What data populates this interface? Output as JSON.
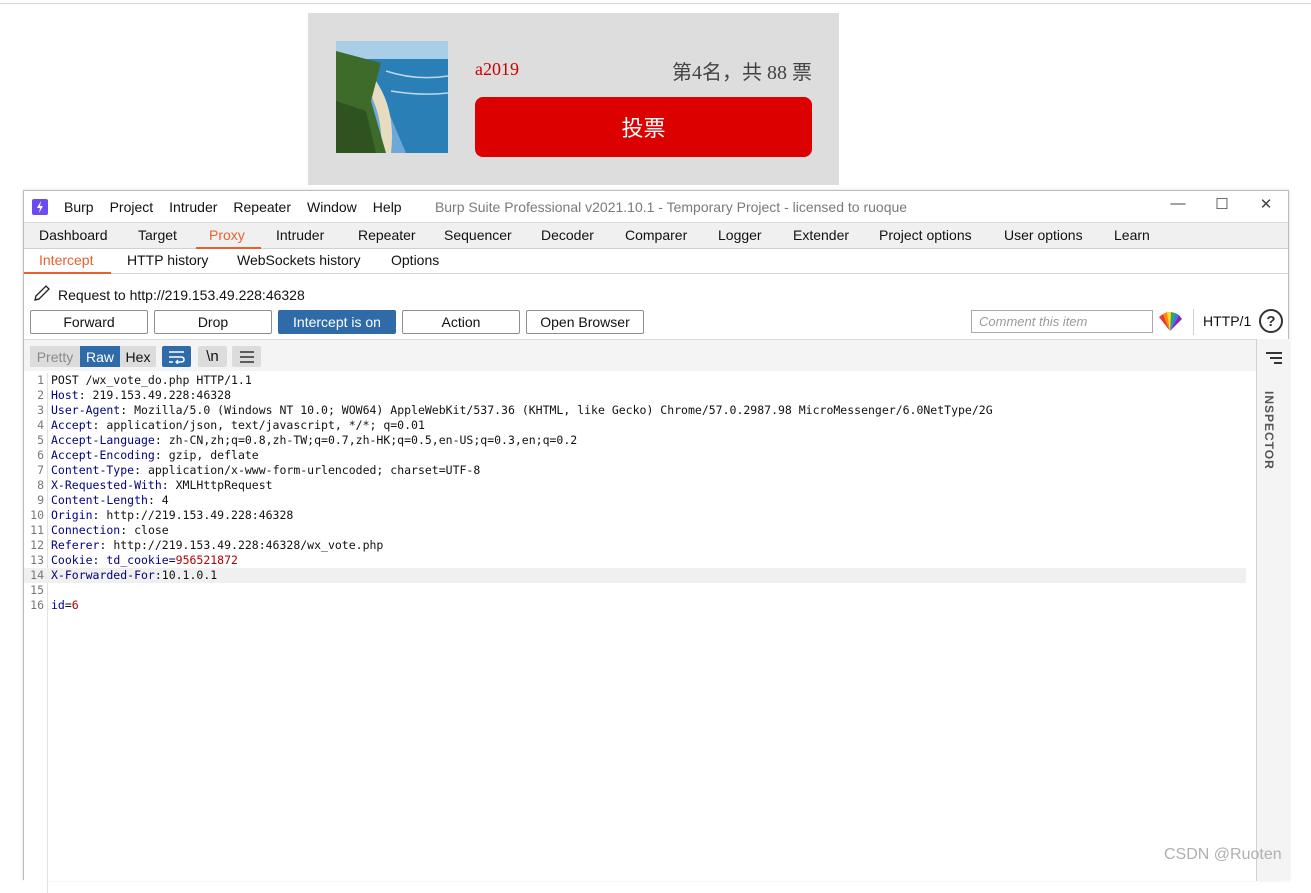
{
  "vote_card": {
    "name": "a2019",
    "rank_text": "第4名，共 88 票",
    "vote_button": "投票",
    "image_desc_icon": "beach-photo"
  },
  "burp": {
    "menu": [
      "Burp",
      "Project",
      "Intruder",
      "Repeater",
      "Window",
      "Help"
    ],
    "title": "Burp Suite Professional v2021.10.1 - Temporary Project - licensed to ruoque",
    "window_controls": [
      "—",
      "☐",
      "✕"
    ],
    "main_tabs": [
      "Dashboard",
      "Target",
      "Proxy",
      "Intruder",
      "Repeater",
      "Sequencer",
      "Decoder",
      "Comparer",
      "Logger",
      "Extender",
      "Project options",
      "User options",
      "Learn"
    ],
    "active_main_tab": "Proxy",
    "sub_tabs": [
      "Intercept",
      "HTTP history",
      "WebSockets history",
      "Options"
    ],
    "active_sub_tab": "Intercept",
    "request_to": "Request to http://219.153.49.228:46328",
    "buttons": {
      "forward": "Forward",
      "drop": "Drop",
      "intercept": "Intercept is on",
      "action": "Action",
      "open_browser": "Open Browser"
    },
    "comment_placeholder": "Comment this item",
    "http_version": "HTTP/1",
    "help": "?",
    "editor_modes": [
      "Pretty",
      "Raw",
      "Hex"
    ],
    "active_editor_mode": "Raw",
    "newline_toggle": "\\n",
    "inspector_label": "INSPECTOR",
    "accent_color": "#e8612c",
    "selected_color": "#2f6ba8",
    "request_lines": [
      {
        "n": "1",
        "key": "",
        "val": "POST /wx_vote_do.php HTTP/1.1"
      },
      {
        "n": "2",
        "key": "Host",
        "val": ": 219.153.49.228:46328"
      },
      {
        "n": "3",
        "key": "User-Agent",
        "val": ": Mozilla/5.0 (Windows NT 10.0; WOW64) AppleWebKit/537.36 (KHTML, like Gecko) Chrome/57.0.2987.98 MicroMessenger/6.0NetType/2G"
      },
      {
        "n": "4",
        "key": "Accept",
        "val": ": application/json, text/javascript, */*; q=0.01"
      },
      {
        "n": "5",
        "key": "Accept-Language",
        "val": ": zh-CN,zh;q=0.8,zh-TW;q=0.7,zh-HK;q=0.5,en-US;q=0.3,en;q=0.2"
      },
      {
        "n": "6",
        "key": "Accept-Encoding",
        "val": ": gzip, deflate"
      },
      {
        "n": "7",
        "key": "Content-Type",
        "val": ": application/x-www-form-urlencoded; charset=UTF-8"
      },
      {
        "n": "8",
        "key": "X-Requested-With",
        "val": ": XMLHttpRequest"
      },
      {
        "n": "9",
        "key": "Content-Length",
        "val": ": 4"
      },
      {
        "n": "10",
        "key": "Origin",
        "val": ": http://219.153.49.228:46328"
      },
      {
        "n": "11",
        "key": "Connection",
        "val": ": close"
      },
      {
        "n": "12",
        "key": "Referer",
        "val": ": http://219.153.49.228:46328/wx_vote.php"
      },
      {
        "n": "13",
        "key": "Cookie",
        "val": ": td_cookie=",
        "extra": "956521872"
      },
      {
        "n": "14",
        "key": "X-Forwarded-For",
        "val": ":10.1.0.1"
      },
      {
        "n": "15",
        "key": "",
        "val": ""
      },
      {
        "n": "16",
        "key": "id",
        "val": "=",
        "extra": "6"
      }
    ]
  },
  "watermark": "CSDN @Ruoten"
}
